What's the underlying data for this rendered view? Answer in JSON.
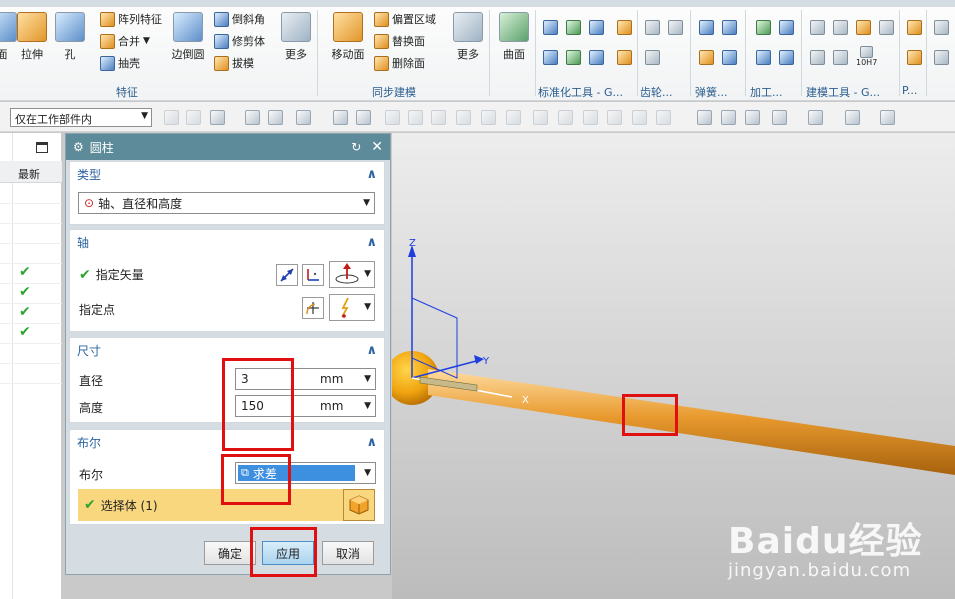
{
  "ribbon": {
    "left_label": "面",
    "extrude": "拉伸",
    "hole": "孔",
    "pattern_feature": "阵列特征",
    "unite": "合并",
    "shell": "抽壳",
    "edge_blend": "边倒圆",
    "chamfer": "倒斜角",
    "trim_body": "修剪体",
    "draft": "拔模",
    "more1": "更多",
    "group_feature": "特征",
    "move_face": "移动面",
    "offset_region": "偏置区域",
    "replace_face": "替换面",
    "delete_face": "删除面",
    "more2": "更多",
    "group_sync": "同步建模",
    "surface": "曲面",
    "group_std": "标准化工具 - G...",
    "group_gear": "齿轮...",
    "group_spring": "弹簧...",
    "group_machining": "加工...",
    "group_modeling": "建模工具 - G...",
    "group_p": "P...",
    "tag_10h7": "10H7"
  },
  "cmdbar": {
    "filter": "仅在工作部件内"
  },
  "navigator": {
    "newest_col": "最新",
    "checks": [
      "✔",
      "✔",
      "✔",
      "✔"
    ]
  },
  "dialog": {
    "title": "圆柱",
    "type_section": "类型",
    "type_value": "轴、直径和高度",
    "axis_section": "轴",
    "specify_vector": "指定矢量",
    "specify_point": "指定点",
    "dim_section": "尺寸",
    "diameter_label": "直径",
    "diameter_value": "3",
    "diameter_unit": "mm",
    "height_label": "高度",
    "height_value": "150",
    "height_unit": "mm",
    "bool_section": "布尔",
    "bool_label": "布尔",
    "bool_value": "求差",
    "select_body": "选择体 (1)",
    "ok": "确定",
    "apply": "应用",
    "cancel": "取消"
  },
  "viewport": {
    "axis_z": "Z",
    "axis_y": "Y",
    "axis_x": "X"
  },
  "watermark": {
    "brand": "Baidu经验",
    "sub": "jingyan.baidu.com"
  },
  "colors": {
    "check": "#2ea52e",
    "dialog_title": "#5e8b99",
    "highlight": "#e01010",
    "selection": "#f9d77e",
    "rod": "#e89a2e"
  }
}
